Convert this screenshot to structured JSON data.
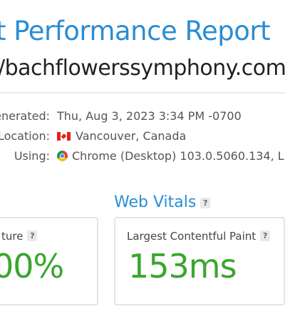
{
  "report": {
    "title": "t Performance Report",
    "url": "/bachflowerssymphony.com"
  },
  "meta": {
    "generated_label": "enerated:",
    "generated_value": "Thu, Aug 3, 2023 3:34 PM -0700",
    "location_label": "Location:",
    "location_value": "Vancouver, Canada",
    "using_label": "Using:",
    "using_value": "Chrome (Desktop) 103.0.5060.134, Li",
    "flag_icon": "canada-flag-icon",
    "browser_icon": "chrome-icon"
  },
  "web_vitals": {
    "heading": "Web Vitals",
    "help": "?"
  },
  "cards": {
    "structure": {
      "label": "ture",
      "help": "?",
      "value": "00%"
    },
    "lcp": {
      "label": "Largest Contentful Paint",
      "help": "?",
      "value": "153ms"
    }
  },
  "colors": {
    "accent_blue": "#2a8dd4",
    "good_green": "#3aa62f"
  }
}
